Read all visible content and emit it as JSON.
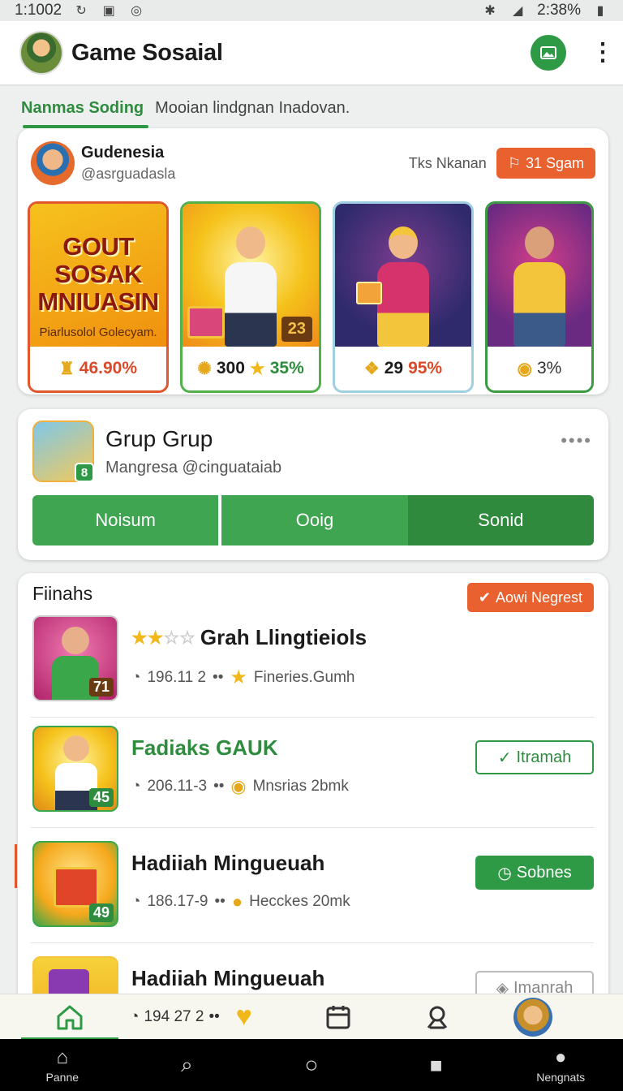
{
  "status_bar": {
    "left_text": "1:1002",
    "right_text": "2:38%"
  },
  "app": {
    "title": "Game Sosaial"
  },
  "subtabs": {
    "active": "Nanmas Soding",
    "other": "Mooian lindgnan Inadovan."
  },
  "feature_card": {
    "poster_name": "Gudenesia",
    "poster_handle": "@asrguadasla",
    "meta": "Tks Nkanan",
    "action_label": "31 Sgam",
    "tiles": [
      {
        "promo_title": "GOUT SOSAK MNIUASIN",
        "promo_sub": "Piarlusolol Golecyam.",
        "value": "46.90%",
        "art_number": ""
      },
      {
        "value": "300",
        "value2": "35%",
        "art_number": "23"
      },
      {
        "value": "29",
        "value2": "95%"
      },
      {
        "value": "3%"
      }
    ]
  },
  "group_card": {
    "name": "Grup Grup",
    "subtitle": "Mangresa @cinguataiab",
    "badge": "8",
    "more": "••••",
    "segments": [
      "Noisum",
      "Ooig",
      "Sonid"
    ]
  },
  "list_card": {
    "heading": "Fiinahs",
    "header_button": "Aowi Negrest",
    "rows": [
      {
        "title": "Grah Llingtieiols",
        "stat": "196.11 2",
        "meta": "Fineries.Gumh",
        "badge": "",
        "button": ""
      },
      {
        "title": "Fadiaks GAUK",
        "stat": "206.11-3",
        "meta": "Mnsrias 2bmk",
        "badge": "45",
        "button": "Itramah"
      },
      {
        "title": "Hadiiah Mingueuah",
        "stat": "186.17-9",
        "meta": "Hecckes 20mk",
        "badge": "49",
        "button": "Sobnes"
      },
      {
        "title": "Hadiiah Mingueuah",
        "button": "Imanrah"
      }
    ],
    "row1_badge": "71"
  },
  "bottom_nav": {
    "stat": "194 27 2"
  },
  "system_nav": {
    "left_label": "Panne",
    "right_label": "Nengnats"
  },
  "colors": {
    "primary_green": "#2e9a45",
    "accent_orange": "#e8612e"
  }
}
